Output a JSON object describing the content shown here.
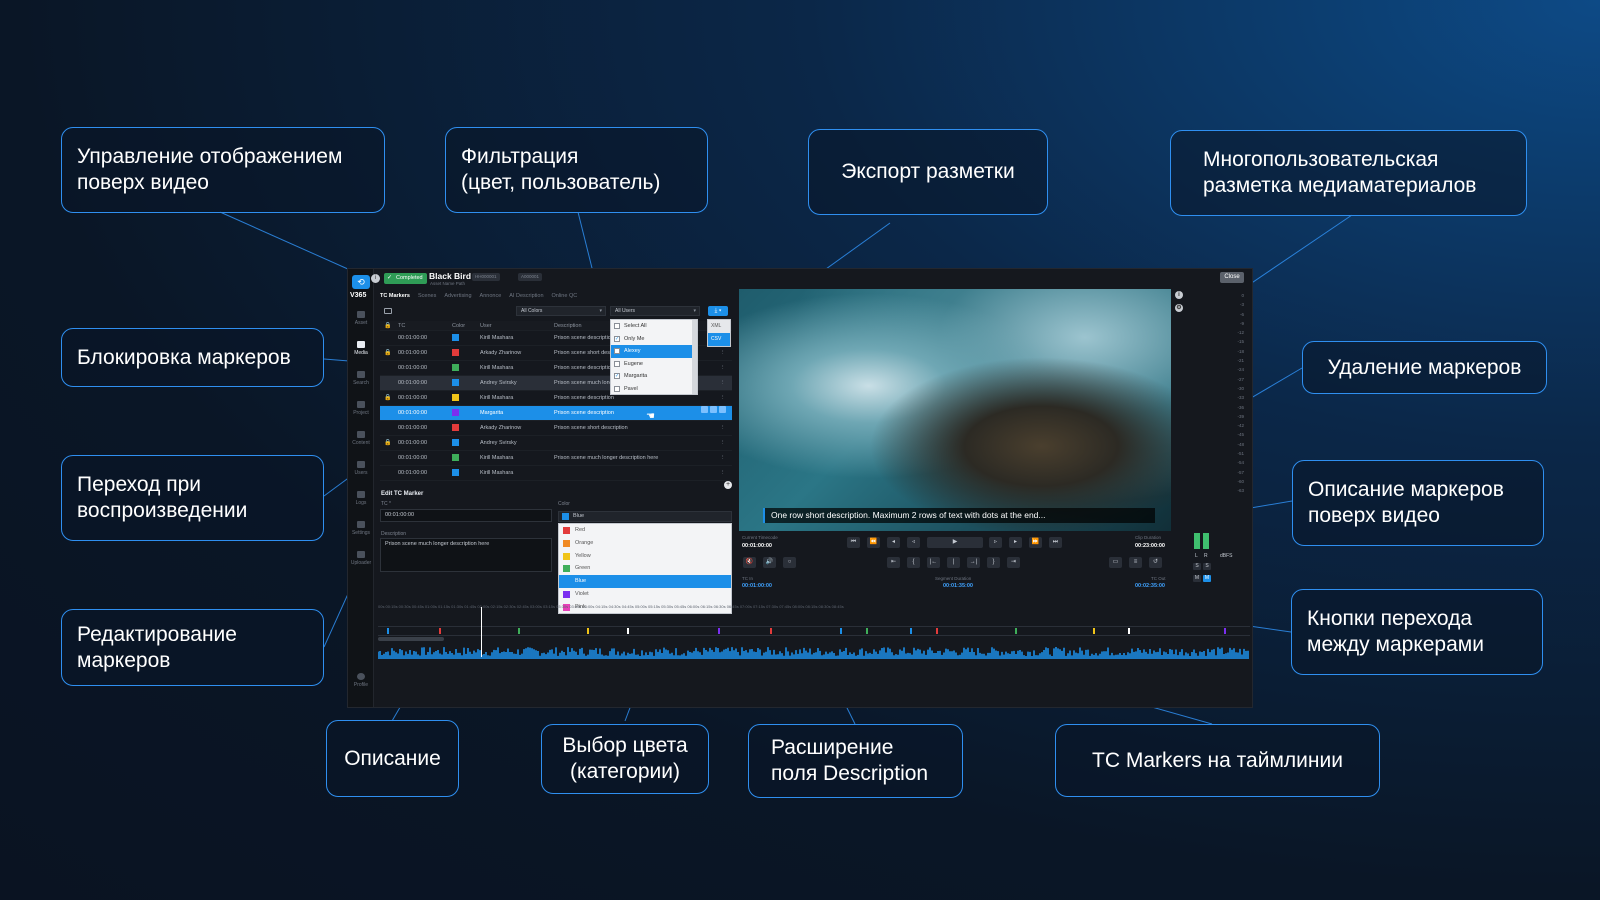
{
  "callouts": {
    "overlay_control": "Управление отображением\nповерх видео",
    "filtering": "Фильтрация\n(цвет, пользователь)",
    "export": "Экспорт разметки",
    "multiuser": "Многопользовательская\nразметка медиаматериалов",
    "lock": "Блокировка маркеров",
    "delete": "Удаление маркеров",
    "jump": "Переход при\nвоспроизведении",
    "overlay_desc": "Описание маркеров\nповерх видео",
    "edit": "Редактирование\nмаркеров",
    "nav_buttons": "Кнопки перехода\nмежду маркерами",
    "description": "Описание",
    "color_pick": "Выбор цвета\n(категории)",
    "expand_desc": "Расширение\nполя Description",
    "timeline": "TC Markers на таймлинии"
  },
  "app": {
    "brand": "V365",
    "status": "Completed",
    "title": "Black Bird",
    "subtitle": "Asset Name Path",
    "chips": [
      "HH000001",
      "A000001"
    ],
    "close": "Close",
    "rail": [
      "Asset",
      "Media",
      "Search",
      "Project",
      "Content",
      "Users",
      "Logs",
      "Settings",
      "Uploader",
      "Profile"
    ],
    "tabs": [
      "TC Markers",
      "Scenes",
      "Advertising",
      "Annonce",
      "AI Description",
      "Online QC"
    ],
    "filters": {
      "colors": "All Colors",
      "users": "All Users"
    },
    "columns": {
      "tc": "TC",
      "color": "Color",
      "user": "User",
      "description": "Description"
    },
    "rows": [
      {
        "tc": "00:01:00:00",
        "color": "#1c8fe8",
        "user": "Kirill Mashara",
        "desc": "Prison scene description",
        "lock": ""
      },
      {
        "tc": "00:01:00:00",
        "color": "#e23b3b",
        "user": "Arkady Zharinow",
        "desc": "Prison scene short description",
        "lock": "🔒"
      },
      {
        "tc": "00:01:00:00",
        "color": "#3fae5a",
        "user": "Kirill Mashara",
        "desc": "Prison scene description",
        "lock": ""
      },
      {
        "tc": "00:01:00:00",
        "color": "#1c8fe8",
        "user": "Andrey Svirsky",
        "desc": "Prison scene much longer description",
        "lock": ""
      },
      {
        "tc": "00:01:00:00",
        "color": "#f0c419",
        "user": "Kirill Mashara",
        "desc": "Prison scene description",
        "lock": "🔒"
      },
      {
        "tc": "00:01:00:00",
        "color": "#7b2ff0",
        "user": "Margarita",
        "desc": "Prison scene description",
        "lock": ""
      },
      {
        "tc": "00:01:00:00",
        "color": "#e23b3b",
        "user": "Arkady Zharinow",
        "desc": "Prison scene short description",
        "lock": ""
      },
      {
        "tc": "00:01:00:00",
        "color": "#1c8fe8",
        "user": "Andrey Svirsky",
        "desc": "",
        "lock": "🔒"
      },
      {
        "tc": "00:01:00:00",
        "color": "#3fae5a",
        "user": "Kirill Mashara",
        "desc": "Prison scene much longer description here",
        "lock": ""
      },
      {
        "tc": "00:01:00:00",
        "color": "#1c8fe8",
        "user": "Kirill Mashara",
        "desc": "",
        "lock": ""
      }
    ],
    "users_dropdown": [
      "Select All",
      "Only Me",
      "Alexey",
      "Eugene",
      "Margarita",
      "Pavel"
    ],
    "export_options": [
      "XML",
      "CSV"
    ],
    "edit": {
      "title": "Edit TC Marker",
      "tc_label": "TC *",
      "tc_value": "00:01:00:00",
      "color_label": "Color",
      "color_value": "Blue",
      "desc_label": "Description",
      "desc_value": "Prison scene much longer description here"
    },
    "colors": [
      {
        "name": "Red",
        "hex": "#e23b3b"
      },
      {
        "name": "Orange",
        "hex": "#f08a24"
      },
      {
        "name": "Yellow",
        "hex": "#f0c419"
      },
      {
        "name": "Green",
        "hex": "#3fae5a"
      },
      {
        "name": "Blue",
        "hex": "#1c8fe8"
      },
      {
        "name": "Violet",
        "hex": "#7b2ff0"
      },
      {
        "name": "Pink",
        "hex": "#e83fb8"
      }
    ],
    "subtitle_overlay": "One row short description. Maximum 2 rows of text with dots at the end...",
    "transport": {
      "current_label": "Current Timecode",
      "current_value": "00:01:00:00",
      "clip_label": "Clip Duration",
      "clip_value": "00:23:00:00",
      "tc_in_label": "TC In",
      "tc_in_value": "00:01:00:00",
      "segment_label": "Segment Duration",
      "segment_value": "00:01:35:00",
      "tc_out_label": "TC Out",
      "tc_out_value": "00:02:35:00"
    },
    "meter": {
      "scale": [
        "0",
        "-3",
        "-6",
        "-9",
        "-12",
        "-15",
        "-18",
        "-21",
        "-24",
        "-27",
        "-30",
        "-33",
        "-36",
        "-39",
        "-42",
        "-45",
        "-48",
        "-51",
        "-54",
        "-57",
        "-60",
        "-63"
      ],
      "l": "L",
      "r": "R",
      "unit": "dBFS",
      "s": "S",
      "m": "M"
    },
    "ruler_text": "00s   00:15s   00:30s   00:45s   01:00s   01:15s   01:30s   01:45s   02:00s   02:15s   02:30s   02:45s   03:00s   03:15s   03:30s   03:45s   04:00s   04:15s   04:30s   04:45s   05:00s   05:15s   05:30s   05:45s   06:00s   06:15s   06:30s   06:45s   07:00s   07:15s   07:30s   07:45s   08:00s   08:15s   08:30s   08:45s",
    "timeline_markers": [
      {
        "pos": 0.01,
        "color": "#1c8fe8"
      },
      {
        "pos": 0.07,
        "color": "#e23b3b"
      },
      {
        "pos": 0.16,
        "color": "#3fae5a"
      },
      {
        "pos": 0.24,
        "color": "#f0c419"
      },
      {
        "pos": 0.285,
        "color": "#ffffff"
      },
      {
        "pos": 0.39,
        "color": "#7b2ff0"
      },
      {
        "pos": 0.45,
        "color": "#e23b3b"
      },
      {
        "pos": 0.53,
        "color": "#1c8fe8"
      },
      {
        "pos": 0.56,
        "color": "#3fae5a"
      },
      {
        "pos": 0.61,
        "color": "#1c8fe8"
      },
      {
        "pos": 0.64,
        "color": "#e23b3b"
      },
      {
        "pos": 0.73,
        "color": "#3fae5a"
      },
      {
        "pos": 0.82,
        "color": "#f0c419"
      },
      {
        "pos": 0.86,
        "color": "#ffffff"
      },
      {
        "pos": 0.97,
        "color": "#7b2ff0"
      }
    ]
  }
}
